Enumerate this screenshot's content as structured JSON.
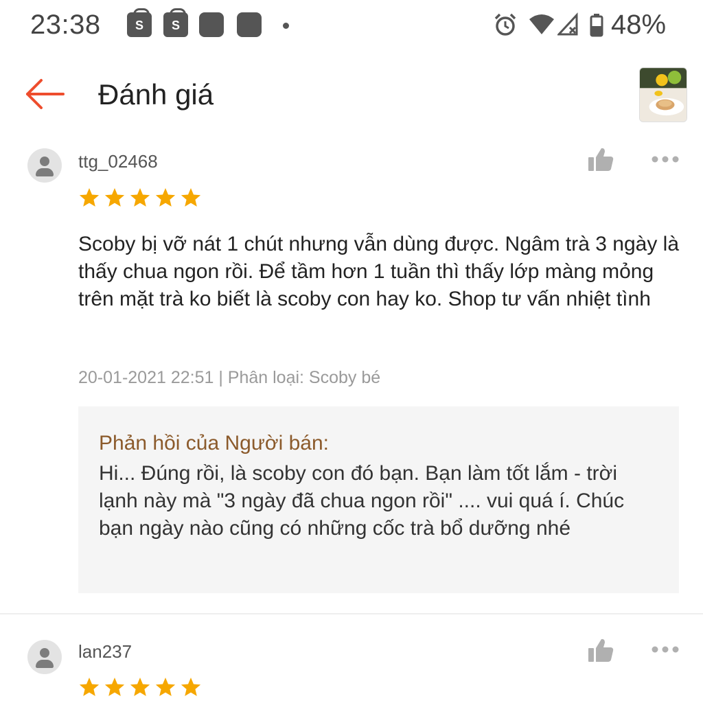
{
  "status_bar": {
    "time": "23:38",
    "shop_icon_letter": "S",
    "battery": "48%",
    "icons": [
      "shopee-bag-icon",
      "shopee-bag-icon",
      "notification-square-icon",
      "notification-square-icon",
      "dot-icon",
      "alarm-icon",
      "wifi-icon",
      "signal-icon",
      "battery-icon"
    ]
  },
  "header": {
    "title": "Đánh giá",
    "back_icon": "arrow-left-icon"
  },
  "colors": {
    "accent": "#ee4d2d",
    "star": "#f6a700",
    "reply_title": "#8b5a2b",
    "reply_bg": "#f5f5f5"
  },
  "reviews": [
    {
      "username": "ttg_02468",
      "rating": 5,
      "text": "Scoby bị vỡ nát 1 chút nhưng vẫn dùng được. Ngâm trà 3 ngày là thấy chua ngon rồi. Để tầm hơn 1 tuần thì thấy lớp màng mỏng trên mặt trà ko biết là scoby con hay ko. Shop tư vấn nhiệt tình",
      "meta": "20-01-2021 22:51 | Phân loại: Scoby bé",
      "reply": {
        "title": "Phản hồi của Người bán:",
        "text": "Hi... Đúng rồi, là scoby con đó bạn. Bạn làm tốt lắm - trời lạnh này mà \"3 ngày đã chua ngon rồi\" .... vui quá í. Chúc bạn ngày nào cũng có những cốc trà bổ dưỡng nhé"
      }
    },
    {
      "username": "lan237",
      "rating": 5
    }
  ]
}
